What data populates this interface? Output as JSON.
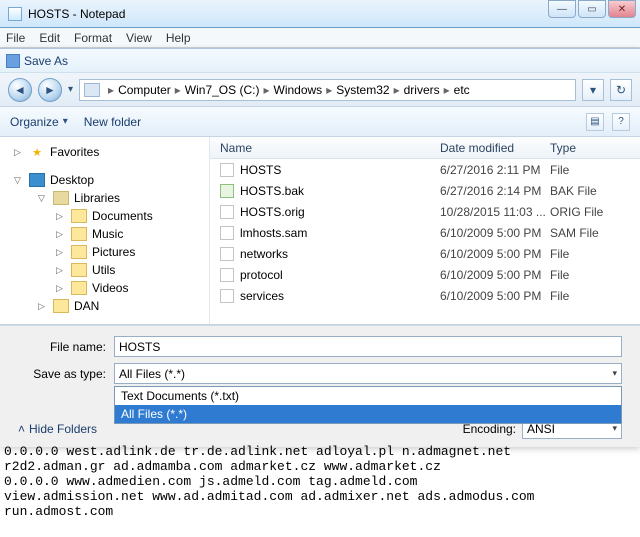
{
  "notepad": {
    "title": "HOSTS - Notepad",
    "menu": {
      "file": "File",
      "edit": "Edit",
      "format": "Format",
      "view": "View",
      "help": "Help"
    }
  },
  "saveas": {
    "title": "Save As",
    "breadcrumb": [
      "Computer",
      "Win7_OS (C:)",
      "Windows",
      "System32",
      "drivers",
      "etc"
    ],
    "toolbar": {
      "organize": "Organize",
      "new_folder": "New folder"
    },
    "columns": {
      "name": "Name",
      "date": "Date modified",
      "type": "Type"
    },
    "files": [
      {
        "name": "HOSTS",
        "date": "6/27/2016 2:11 PM",
        "type": "File",
        "icon": "plain"
      },
      {
        "name": "HOSTS.bak",
        "date": "6/27/2016 2:14 PM",
        "type": "BAK File",
        "icon": "bak"
      },
      {
        "name": "HOSTS.orig",
        "date": "10/28/2015 11:03 ...",
        "type": "ORIG File",
        "icon": "plain"
      },
      {
        "name": "lmhosts.sam",
        "date": "6/10/2009 5:00 PM",
        "type": "SAM File",
        "icon": "plain"
      },
      {
        "name": "networks",
        "date": "6/10/2009 5:00 PM",
        "type": "File",
        "icon": "plain"
      },
      {
        "name": "protocol",
        "date": "6/10/2009 5:00 PM",
        "type": "File",
        "icon": "plain"
      },
      {
        "name": "services",
        "date": "6/10/2009 5:00 PM",
        "type": "File",
        "icon": "plain"
      }
    ],
    "nav": {
      "favorites": "Favorites",
      "desktop": "Desktop",
      "libraries": "Libraries",
      "lib_items": [
        "Documents",
        "Music",
        "Pictures",
        "Utils",
        "Videos"
      ],
      "other": "DAN"
    },
    "filename_label": "File name:",
    "filename_value": "HOSTS",
    "saveastype_label": "Save as type:",
    "saveastype_value": "All Files  (*.*)",
    "type_options": [
      "Text Documents (*.txt)",
      "All Files  (*.*)"
    ],
    "hide_folders": "Hide Folders",
    "encoding_label": "Encoding:",
    "encoding_value": "ANSI"
  },
  "hosts_text": "0.0.0.0 west.adlink.de tr.de.adlink.net adloyal.pl n.admagnet.net\nr2d2.adman.gr ad.admamba.com admarket.cz www.admarket.cz\n0.0.0.0 www.admedien.com js.admeld.com tag.admeld.com\nview.admission.net www.ad.admitad.com ad.admixer.net ads.admodus.com\nrun.admost.com"
}
